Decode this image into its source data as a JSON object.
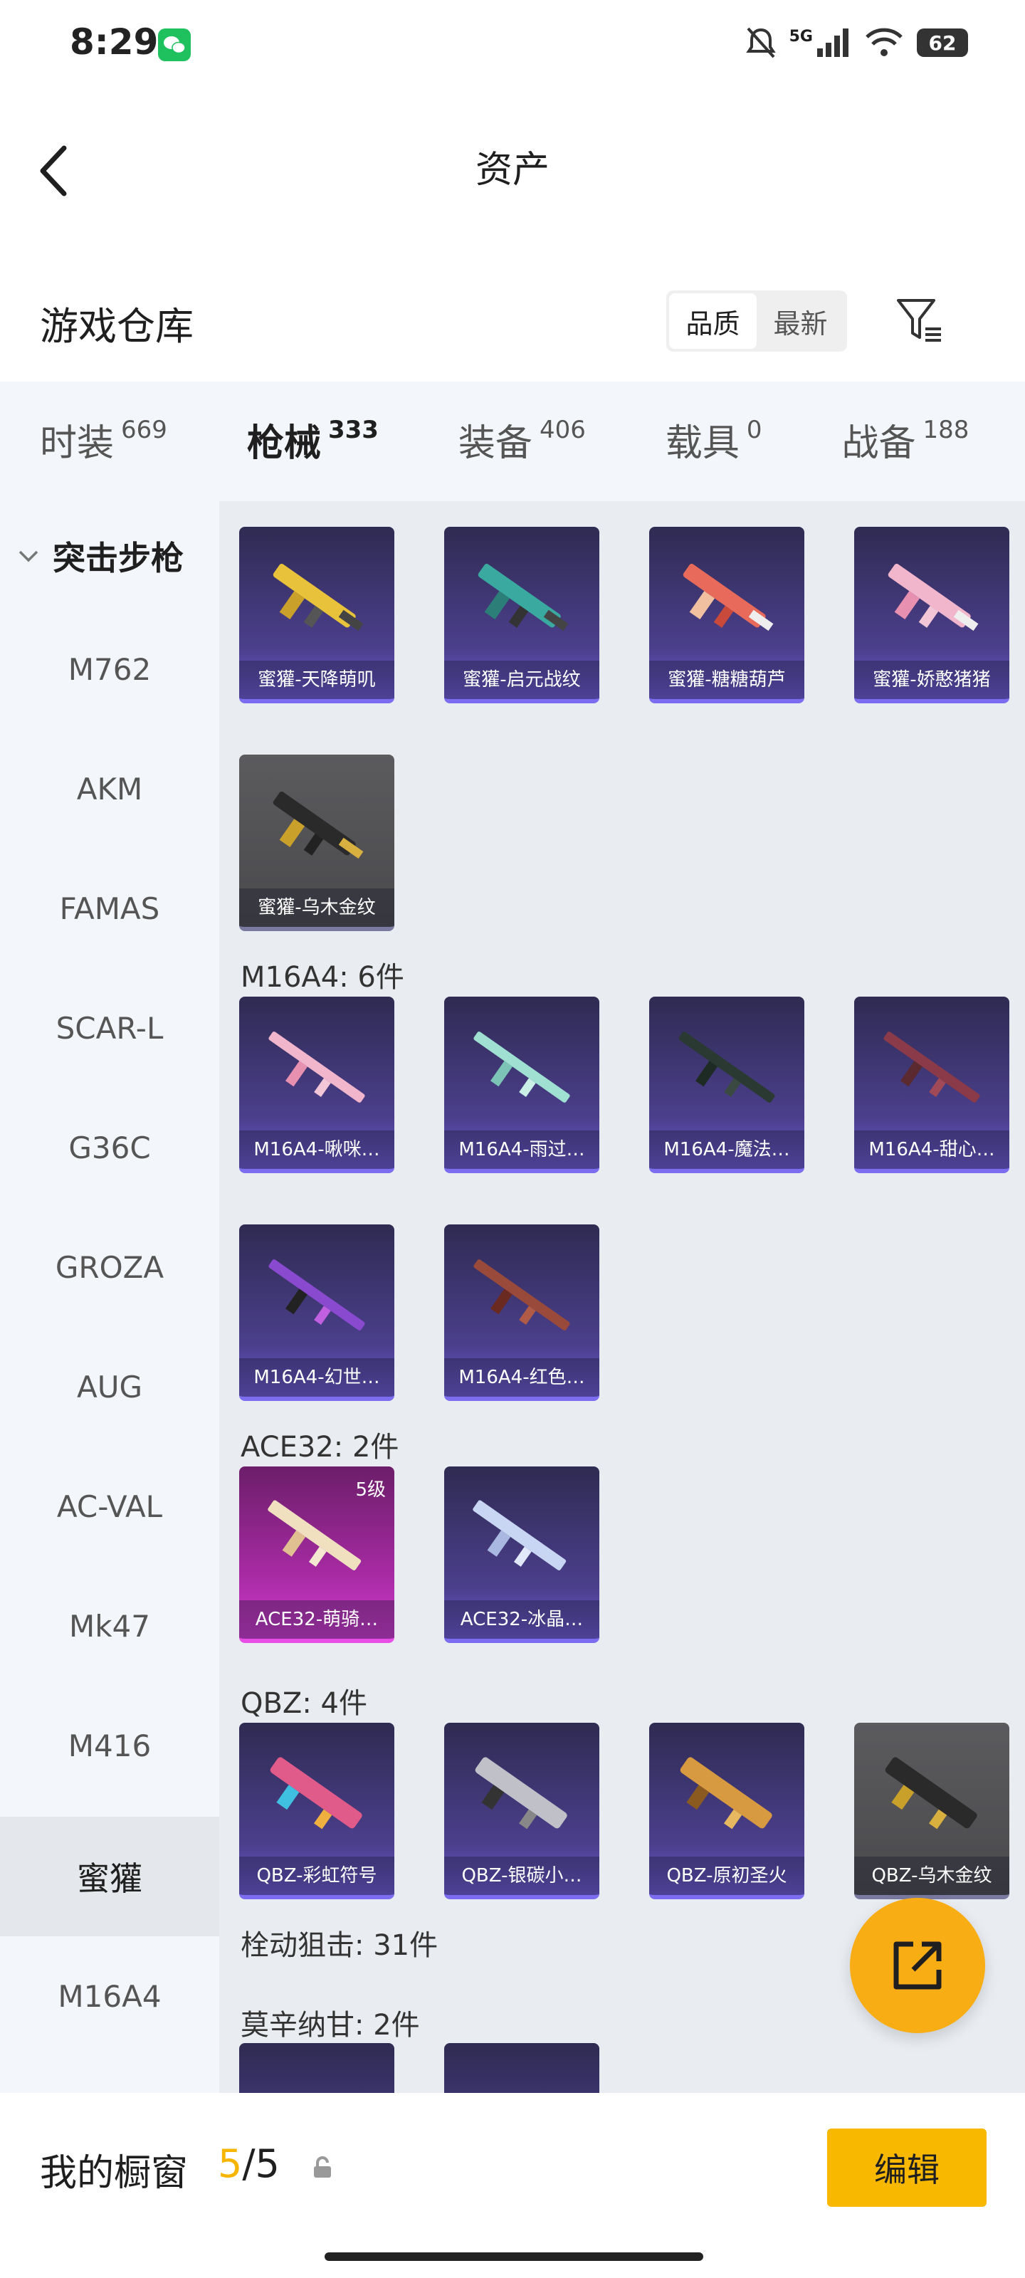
{
  "status_bar": {
    "time": "8:29",
    "network": "5G",
    "battery": "62"
  },
  "header": {
    "title": "资产"
  },
  "warehouse": {
    "title": "游戏仓库",
    "sort_options": [
      "品质",
      "最新"
    ],
    "sort_active": "品质"
  },
  "tabs": [
    {
      "label": "时装",
      "count": "669"
    },
    {
      "label": "枪械",
      "count": "333",
      "active": true
    },
    {
      "label": "装备",
      "count": "406"
    },
    {
      "label": "载具",
      "count": "0"
    },
    {
      "label": "战备",
      "count": "188"
    }
  ],
  "sidebar": {
    "group": "突击步枪",
    "items": [
      "M762",
      "AKM",
      "FAMAS",
      "SCAR-L",
      "G36C",
      "GROZA",
      "AUG",
      "AC-VAL",
      "Mk47",
      "M416",
      "蜜獾",
      "M16A4"
    ],
    "active_item": "蜜獾"
  },
  "sections": {
    "honeybadger": {
      "cards": [
        "蜜獾-天降萌叽",
        "蜜獾-启元战纹",
        "蜜獾-糖糖葫芦",
        "蜜獾-娇憨猪猪",
        "蜜獾-乌木金纹"
      ]
    },
    "m16a4": {
      "title": "M16A4: 6件",
      "cards": [
        "M16A4-啾咪…",
        "M16A4-雨过…",
        "M16A4-魔法…",
        "M16A4-甜心…",
        "M16A4-幻世…",
        "M16A4-红色…"
      ]
    },
    "ace32": {
      "title": "ACE32: 2件",
      "cards": [
        "ACE32-萌骑…",
        "ACE32-冰晶…"
      ],
      "level_badge": "5级"
    },
    "qbz": {
      "title": "QBZ: 4件",
      "cards": [
        "QBZ-彩虹符号",
        "QBZ-银碳小…",
        "QBZ-原初圣火",
        "QBZ-乌木金纹"
      ]
    },
    "bolt": {
      "title": "栓动狙击: 31件"
    },
    "mosin": {
      "title": "莫辛纳甘: 2件"
    }
  },
  "bottom": {
    "label": "我的橱窗",
    "count_current": "5",
    "count_total": "/5",
    "edit_label": "编辑"
  },
  "colors": {
    "accent": "#f6b500",
    "fab": "#f8ad14",
    "card_purple": "#4b3f8c",
    "card_pink": "#a42aa0",
    "card_grey": "#505053"
  }
}
